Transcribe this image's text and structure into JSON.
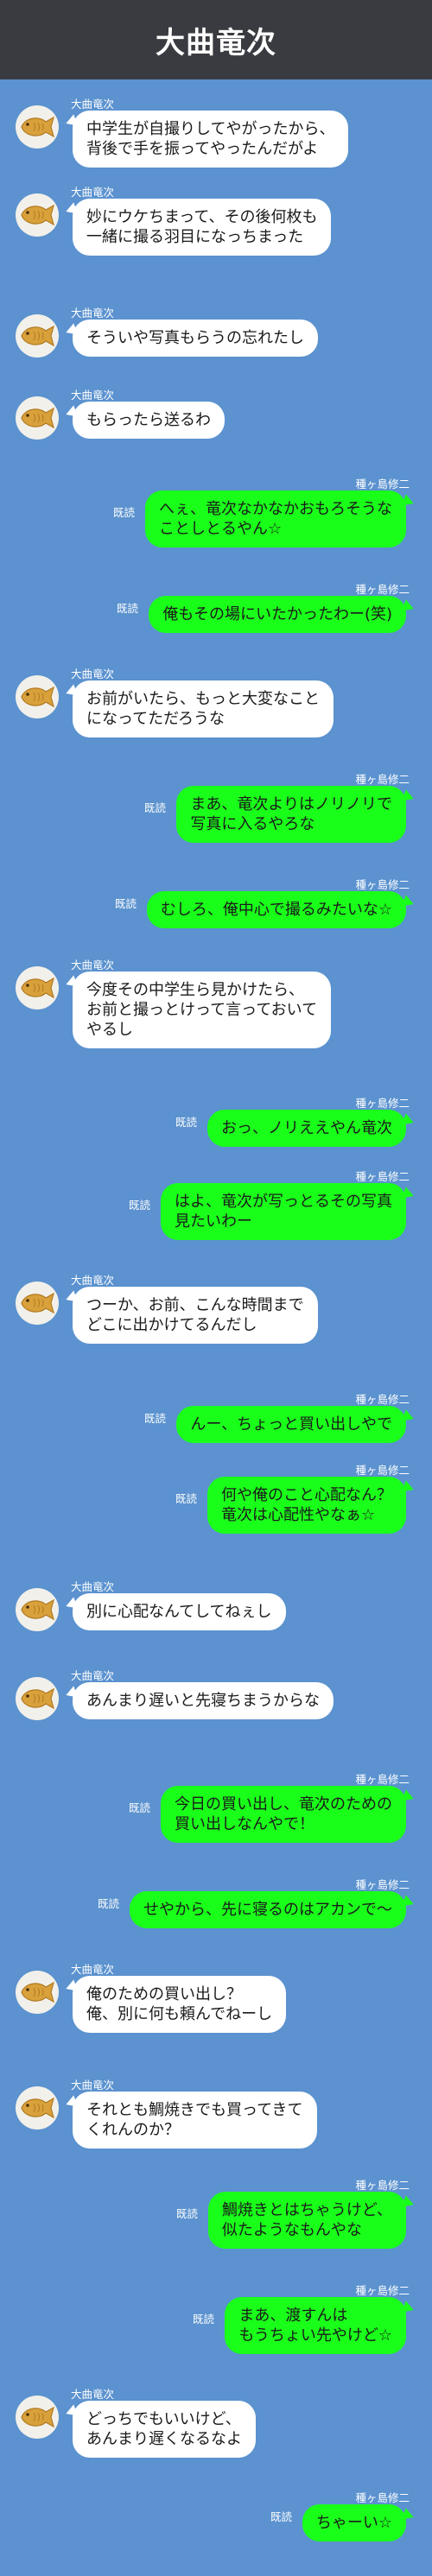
{
  "header": {
    "title": "大曲竜次"
  },
  "messages": [
    {
      "side": "left",
      "sender": "大曲竜次",
      "text": "中学生が自撮りしてやがったから、\n背後で手を振ってやったんだがよ",
      "read": ""
    },
    {
      "side": "left",
      "sender": "大曲竜次",
      "text": "妙にウケちまって、その後何枚も\n一緒に撮る羽目になっちまった",
      "read": ""
    },
    {
      "side": "left",
      "sender": "大曲竜次",
      "text": "そういや写真もらうの忘れたし",
      "read": ""
    },
    {
      "side": "left",
      "sender": "大曲竜次",
      "text": "もらったら送るわ",
      "read": ""
    },
    {
      "side": "right",
      "sender": "種ヶ島修二",
      "text": "へぇ、竜次なかなかおもろそうな\nことしとるやん☆",
      "read": "既読"
    },
    {
      "side": "right",
      "sender": "種ヶ島修二",
      "text": "俺もその場にいたかったわー(笑)",
      "read": "既読"
    },
    {
      "side": "left",
      "sender": "大曲竜次",
      "text": "お前がいたら、もっと大変なこと\nになってただろうな",
      "read": ""
    },
    {
      "side": "right",
      "sender": "種ヶ島修二",
      "text": "まあ、竜次よりはノリノリで\n写真に入るやろな",
      "read": "既読"
    },
    {
      "side": "right",
      "sender": "種ヶ島修二",
      "text": "むしろ、俺中心で撮るみたいな☆",
      "read": "既読"
    },
    {
      "side": "left",
      "sender": "大曲竜次",
      "text": "今度その中学生ら見かけたら、\nお前と撮っとけって言っておいて\nやるし",
      "read": ""
    },
    {
      "side": "right",
      "sender": "種ヶ島修二",
      "text": "おっ、ノリええやん竜次",
      "read": "既読"
    },
    {
      "side": "right",
      "sender": "種ヶ島修二",
      "text": "はよ、竜次が写っとるその写真\n見たいわー",
      "read": "既読"
    },
    {
      "side": "left",
      "sender": "大曲竜次",
      "text": "つーか、お前、こんな時間まで\nどこに出かけてるんだし",
      "read": ""
    },
    {
      "side": "right",
      "sender": "種ヶ島修二",
      "text": "んー、ちょっと買い出しやで",
      "read": "既読"
    },
    {
      "side": "right",
      "sender": "種ヶ島修二",
      "text": "何や俺のこと心配なん？\n竜次は心配性やなぁ☆",
      "read": "既読"
    },
    {
      "side": "left",
      "sender": "大曲竜次",
      "text": "別に心配なんてしてねぇし",
      "read": ""
    },
    {
      "side": "left",
      "sender": "大曲竜次",
      "text": "あんまり遅いと先寝ちまうからな",
      "read": ""
    },
    {
      "side": "right",
      "sender": "種ヶ島修二",
      "text": "今日の買い出し、竜次のための\n買い出しなんやで！",
      "read": "既読"
    },
    {
      "side": "right",
      "sender": "種ヶ島修二",
      "text": "せやから、先に寝るのはアカンで〜",
      "read": "既読"
    },
    {
      "side": "left",
      "sender": "大曲竜次",
      "text": "俺のための買い出し？\n俺、別に何も頼んでねーし",
      "read": ""
    },
    {
      "side": "left",
      "sender": "大曲竜次",
      "text": "それとも鯛焼きでも買ってきて\nくれんのか？",
      "read": ""
    },
    {
      "side": "right",
      "sender": "種ヶ島修二",
      "text": "鯛焼きとはちゃうけど、\n似たようなもんやな",
      "read": "既読"
    },
    {
      "side": "right",
      "sender": "種ヶ島修二",
      "text": "まあ、渡すんは\nもうちょい先やけど☆",
      "read": "既読"
    },
    {
      "side": "left",
      "sender": "大曲竜次",
      "text": "どっちでもいいけど、\nあんまり遅くなるなよ",
      "read": ""
    },
    {
      "side": "right",
      "sender": "種ヶ島修二",
      "text": "ちゃーい☆",
      "read": "既読"
    }
  ],
  "avatar": {
    "icon": "taiyaki-icon"
  },
  "colors": {
    "background": "#5b92cf",
    "header": "#3a3b40",
    "left_bubble": "#ffffff",
    "right_bubble": "#1aff1a"
  }
}
